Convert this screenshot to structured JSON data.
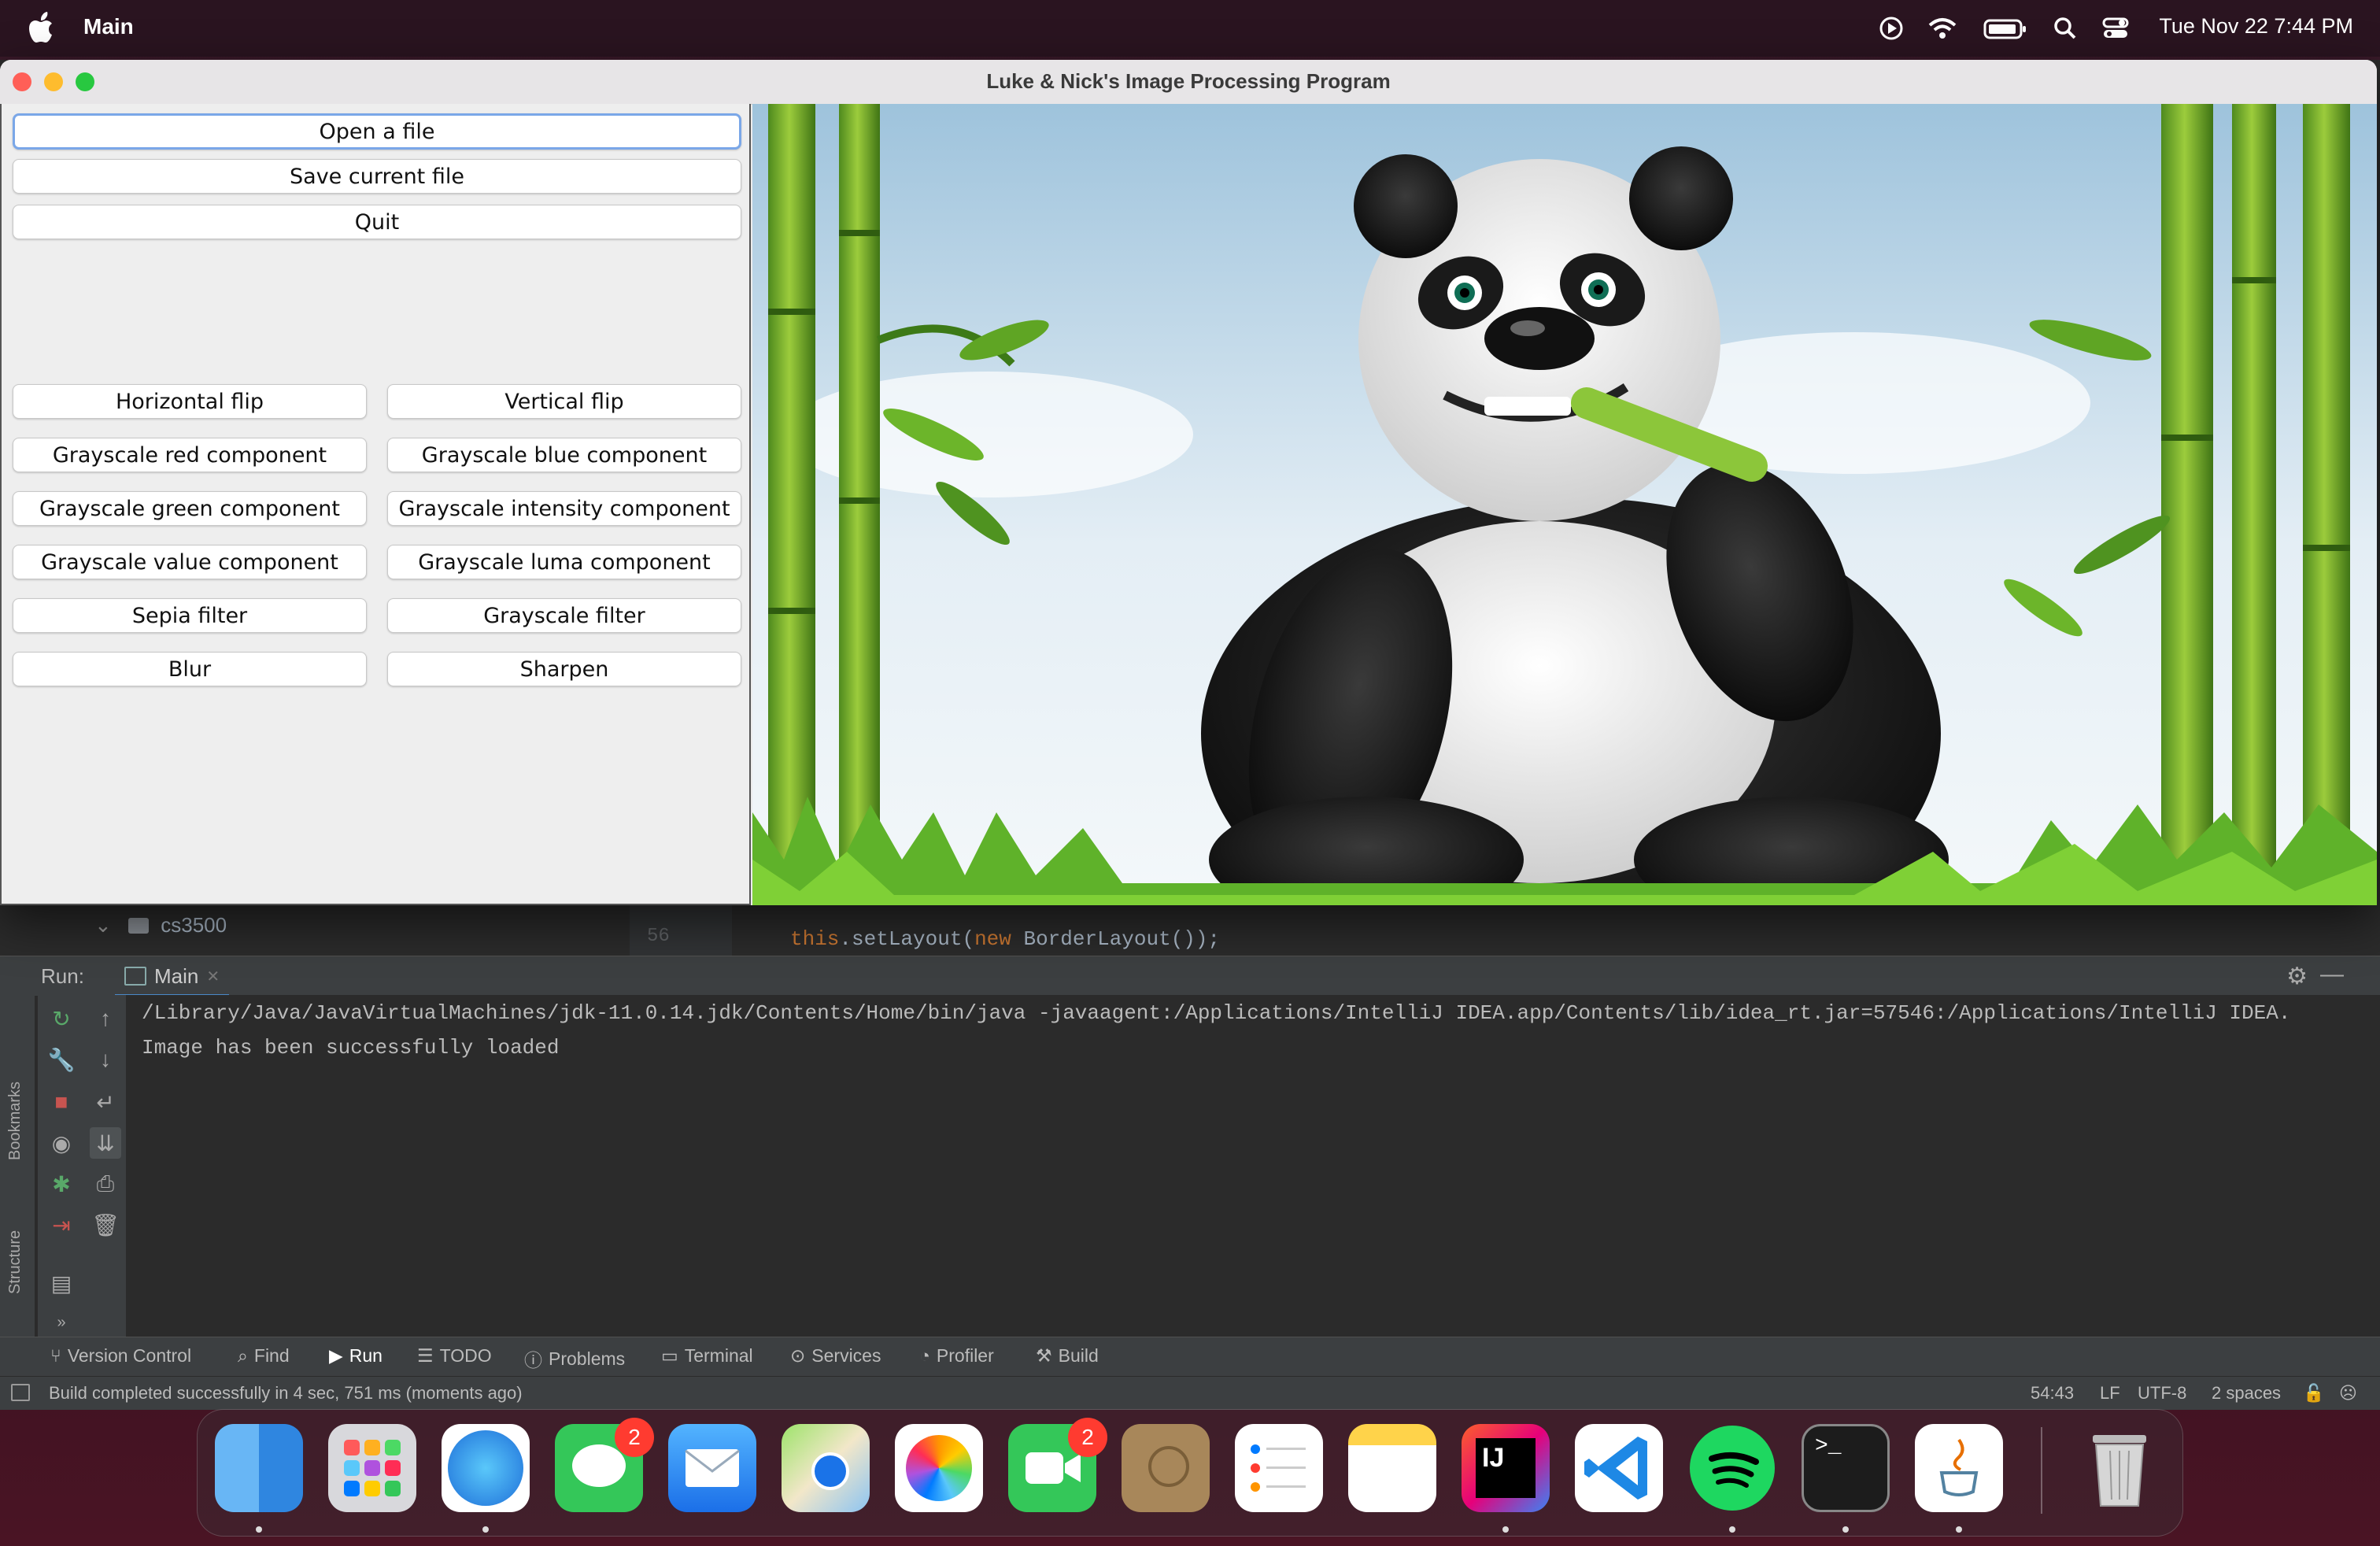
{
  "menubar": {
    "app_name": "Main",
    "clock": "Tue Nov 22  7:44 PM",
    "status_icons": [
      "play-icon",
      "wifi-icon",
      "battery-icon",
      "search-icon",
      "control-center-icon"
    ]
  },
  "window": {
    "title": "Luke & Nick's Image Processing Program",
    "file_buttons": [
      "Open a file",
      "Save current file",
      "Quit"
    ],
    "op_buttons": [
      [
        "Horizontal flip",
        "Vertical flip"
      ],
      [
        "Grayscale red component",
        "Grayscale blue component"
      ],
      [
        "Grayscale green component",
        "Grayscale intensity component"
      ],
      [
        "Grayscale value component",
        "Grayscale luma component"
      ],
      [
        "Sepia filter",
        "Grayscale filter"
      ],
      [
        "Blur",
        "Sharpen"
      ]
    ]
  },
  "ide": {
    "tree_folder": "cs3500",
    "line_number": "56",
    "code": {
      "pre": "this",
      "mid": ".setLayout(",
      "kw": "new",
      "post": " BorderLayout());"
    },
    "run_label": "Run:",
    "run_tab": "Main",
    "console_lines": [
      "/Library/Java/JavaVirtualMachines/jdk-11.0.14.jdk/Contents/Home/bin/java -javaagent:/Applications/IntelliJ IDEA.app/Contents/lib/idea_rt.jar=57546:/Applications/IntelliJ IDEA.",
      "Image has been successfully loaded"
    ],
    "side_labels": [
      "Bookmarks",
      "Structure"
    ],
    "bottom_tabs": [
      "Version Control",
      "Find",
      "Run",
      "TODO",
      "Problems",
      "Terminal",
      "Services",
      "Profiler",
      "Build"
    ],
    "status_message": "Build completed successfully in 4 sec, 751 ms (moments ago)",
    "status_right": [
      "54:43",
      "LF",
      "UTF-8",
      "2 spaces"
    ]
  },
  "dock": {
    "messages_badge": "2",
    "facetime_badge": "2",
    "intellij_label": "IJ"
  }
}
